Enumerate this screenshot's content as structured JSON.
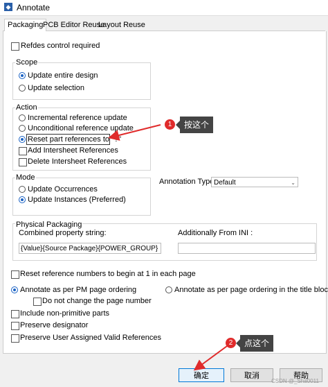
{
  "window": {
    "title": "Annotate",
    "icon": "app-icon"
  },
  "tabs": [
    "Packaging",
    "PCB Editor Reuse",
    "Layout Reuse"
  ],
  "refdes_control": {
    "label": "Refdes control required",
    "checked": false
  },
  "scope": {
    "title": "Scope",
    "options": [
      "Update entire design",
      "Update selection"
    ],
    "selected": 0
  },
  "action": {
    "title": "Action",
    "options": [
      "Incremental reference update",
      "Unconditional reference update",
      "Reset part references to \"?\"",
      "Add Intersheet References",
      "Delete Intersheet References"
    ],
    "selected": 2
  },
  "mode": {
    "title": "Mode",
    "options": [
      "Update Occurrences",
      "Update Instances (Preferred)"
    ],
    "selected": 1
  },
  "annotation_type": {
    "label": "Annotation Type",
    "value": "Default"
  },
  "physical_packaging": {
    "title": "Physical Packaging",
    "combined_label": "Combined property string:",
    "combined_value": "{Value}{Source Package}{POWER_GROUP}",
    "additional_label": "Additionally From INI :",
    "additional_value": ""
  },
  "reset_numbers": {
    "label": "Reset reference numbers to begin at 1 in each page",
    "checked": false
  },
  "ordering": {
    "options": [
      "Annotate as per PM page ordering",
      "Annotate as per page ordering in the title blocks"
    ],
    "selected": 0
  },
  "no_change_page": {
    "label": "Do not change the page number",
    "checked": false
  },
  "include_non_primitive": {
    "label": "Include non-primitive parts",
    "checked": false
  },
  "preserve_designator": {
    "label": "Preserve designator",
    "checked": false
  },
  "preserve_user": {
    "label": "Preserve User Assigned Valid References",
    "checked": false
  },
  "annotations": {
    "callout1": {
      "number": "1",
      "text": "按这个"
    },
    "callout2": {
      "number": "2",
      "text": "点这个"
    },
    "arrow_color": "#e02b2b"
  },
  "buttons": {
    "ok": "确定",
    "cancel": "取消",
    "help": "帮助"
  },
  "watermark": "CSDN @_Sha0011"
}
